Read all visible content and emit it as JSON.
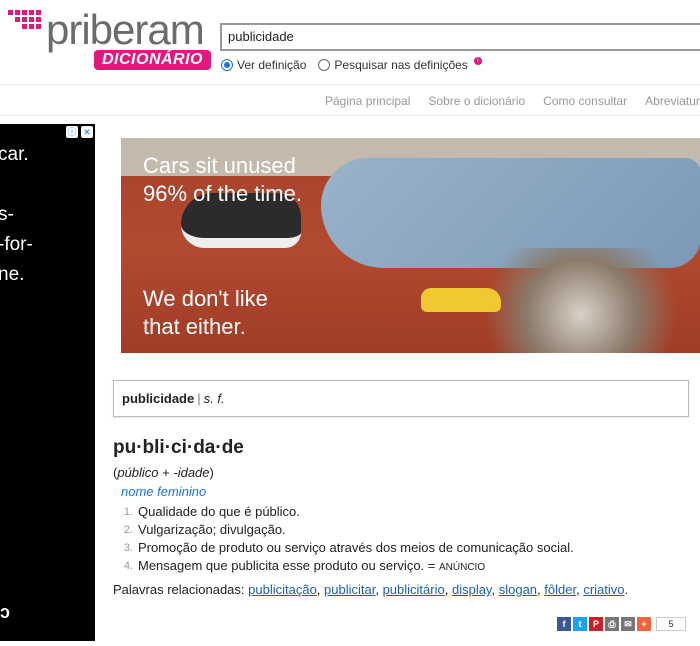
{
  "logo": {
    "word": "priberam",
    "badge": "DICIONÁRIO"
  },
  "search": {
    "value": "publicidade"
  },
  "search_mode": {
    "option1": "Ver definição",
    "option2": "Pesquisar nas definições"
  },
  "nav": [
    "Página principal",
    "Sobre o dicionário",
    "Como consultar",
    "Abreviatura"
  ],
  "side_ad": {
    "text": "car.\n\ns-\n-for-\nne.",
    "mark": "ↄ"
  },
  "banner": {
    "line1": "Cars sit unused\n96% of the time.",
    "line2": "We don't like\nthat either."
  },
  "entry": {
    "word": "publicidade",
    "separator": "|",
    "pos": "s. f."
  },
  "definition": {
    "syllables": "pu·bli·ci·da·de",
    "etym_open": "(",
    "etym_base": "público",
    "etym_plus": " + ",
    "etym_suffix": "-idade",
    "etym_close": ")",
    "gram_class": "nome feminino",
    "senses": [
      {
        "num": "1.",
        "text": "Qualidade do que é público."
      },
      {
        "num": "2.",
        "text": "Vulgarização; divulgação."
      },
      {
        "num": "3.",
        "text": "Promoção de produto ou serviço através dos meios de comunicação social."
      },
      {
        "num": "4.",
        "text": "Mensagem que publicita esse produto ou serviço. = ",
        "xref": "ANÚNCIO"
      }
    ]
  },
  "related": {
    "label": "Palavras relacionadas: ",
    "words": [
      "publicitação",
      "publicitar",
      "publicitário",
      "display",
      "slogan",
      "fôlder",
      "criativo"
    ],
    "end": "."
  },
  "share": {
    "count": "5",
    "colors": {
      "facebook": "#3b5998",
      "twitter": "#1da1f2",
      "pinterest": "#cb2027",
      "print": "#777777",
      "email": "#777777",
      "more": "#f0643c"
    }
  },
  "colors": {
    "brand": "#e0197d",
    "link": "#1a5fb4",
    "gram": "#1a73e8"
  }
}
